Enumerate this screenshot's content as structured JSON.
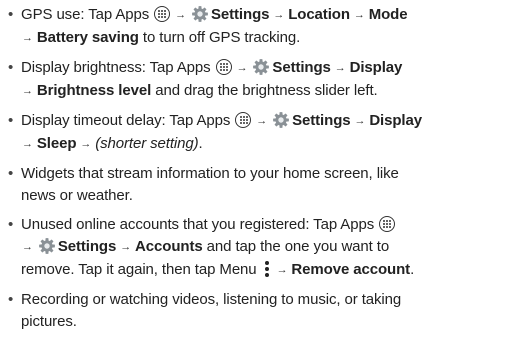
{
  "tips": [
    {
      "parts": [
        {
          "t": "GPS use: Tap Apps "
        },
        {
          "icon": "apps"
        },
        {
          "arrow": true
        },
        {
          "icon": "settings"
        },
        {
          "t": "Settings",
          "b": true
        },
        {
          "arrow": true
        },
        {
          "t": "Location",
          "b": true
        },
        {
          "arrow": true
        },
        {
          "t": "Mode",
          "b": true
        },
        {
          "br": true
        },
        {
          "arrow": true
        },
        {
          "t": "Battery saving",
          "b": true
        },
        {
          "t": " to turn off GPS tracking."
        }
      ]
    },
    {
      "parts": [
        {
          "t": "Display brightness: Tap Apps "
        },
        {
          "icon": "apps"
        },
        {
          "arrow": true
        },
        {
          "icon": "settings"
        },
        {
          "t": "Settings",
          "b": true
        },
        {
          "arrow": true
        },
        {
          "t": "Display",
          "b": true
        },
        {
          "br": true
        },
        {
          "arrow": true
        },
        {
          "t": "Brightness level",
          "b": true
        },
        {
          "t": " and drag the brightness slider left."
        }
      ]
    },
    {
      "parts": [
        {
          "t": "Display timeout delay: Tap Apps "
        },
        {
          "icon": "apps"
        },
        {
          "arrow": true
        },
        {
          "icon": "settings"
        },
        {
          "t": "Settings",
          "b": true
        },
        {
          "arrow": true
        },
        {
          "t": "Display",
          "b": true
        },
        {
          "br": true
        },
        {
          "arrow": true
        },
        {
          "t": "Sleep",
          "b": true
        },
        {
          "arrow": true
        },
        {
          "t": "(shorter setting)",
          "i": true
        },
        {
          "t": "."
        }
      ]
    },
    {
      "parts": [
        {
          "t": "Widgets that stream information to your home screen, like"
        },
        {
          "br": true
        },
        {
          "t": "news or weather."
        }
      ]
    },
    {
      "parts": [
        {
          "t": "Unused online accounts that you registered: Tap Apps "
        },
        {
          "icon": "apps"
        },
        {
          "br": true
        },
        {
          "arrow": true
        },
        {
          "icon": "settings"
        },
        {
          "t": "Settings",
          "b": true
        },
        {
          "arrow": true
        },
        {
          "t": "Accounts",
          "b": true
        },
        {
          "t": " and tap the one you want to"
        },
        {
          "br": true
        },
        {
          "t": "remove. Tap it again, then tap Menu "
        },
        {
          "icon": "menu"
        },
        {
          "arrow": true
        },
        {
          "t": "Remove account",
          "b": true
        },
        {
          "t": "."
        }
      ]
    },
    {
      "parts": [
        {
          "t": "Recording or watching videos, listening to music, or taking"
        },
        {
          "br": true
        },
        {
          "t": "pictures."
        }
      ]
    }
  ],
  "symbols": {
    "bullet": "•",
    "arrow": "→"
  },
  "colors": {
    "text": "#222222",
    "gear_body": "#8a9196",
    "gear_center": "#e9ecee"
  }
}
